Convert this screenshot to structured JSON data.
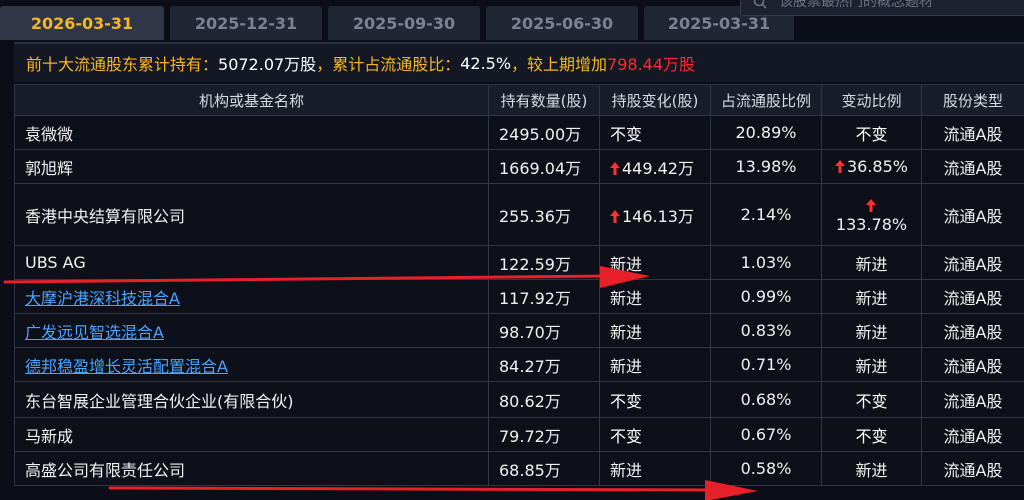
{
  "tabs": [
    {
      "label": "2026-03-31",
      "active": true
    },
    {
      "label": "2025-12-31",
      "active": false
    },
    {
      "label": "2025-09-30",
      "active": false
    },
    {
      "label": "2025-06-30",
      "active": false
    },
    {
      "label": "2025-03-31",
      "active": false
    }
  ],
  "search": {
    "placeholder": "该股票最热门的概念题材"
  },
  "summary": {
    "label_total": "前十大流通股东累计持有：",
    "total_value": "5072.07万股",
    "label_ratio": "，累计占流通股比：",
    "ratio_value": "42.5%",
    "label_change": "，较上期增加",
    "change_value": "798.44万股"
  },
  "table": {
    "headers": [
      "机构或基金名称",
      "持有数量(股)",
      "持股变化(股)",
      "占流通股比例",
      "变动比例",
      "股份类型"
    ],
    "rows": [
      {
        "name": "袁微微",
        "amount": "2495.00万",
        "change": "不变",
        "change_up": false,
        "ratio": "20.89%",
        "vratio": "不变",
        "vratio_up": false,
        "type": "流通A股"
      },
      {
        "name": "郭旭辉",
        "amount": "1669.04万",
        "change": "449.42万",
        "change_up": true,
        "ratio": "13.98%",
        "vratio": "36.85%",
        "vratio_up": true,
        "type": "流通A股"
      },
      {
        "name": "香港中央结算有限公司",
        "amount": "255.36万",
        "change": "146.13万",
        "change_up": true,
        "ratio": "2.14%",
        "vratio": "133.78%",
        "vratio_up": true,
        "type": "流通A股"
      },
      {
        "name": "UBS AG",
        "amount": "122.59万",
        "change": "新进",
        "change_up": false,
        "ratio": "1.03%",
        "vratio": "新进",
        "vratio_up": false,
        "type": "流通A股"
      },
      {
        "name": "大摩沪港深科技混合A",
        "amount": "117.92万",
        "change": "新进",
        "change_up": false,
        "ratio": "0.99%",
        "vratio": "新进",
        "vratio_up": false,
        "type": "流通A股"
      },
      {
        "name": "广发远见智选混合A",
        "amount": "98.70万",
        "change": "新进",
        "change_up": false,
        "ratio": "0.83%",
        "vratio": "新进",
        "vratio_up": false,
        "type": "流通A股"
      },
      {
        "name": "德邦稳盈增长灵活配置混合A",
        "amount": "84.27万",
        "change": "新进",
        "change_up": false,
        "ratio": "0.71%",
        "vratio": "新进",
        "vratio_up": false,
        "type": "流通A股"
      },
      {
        "name": "东台智展企业管理合伙企业(有限合伙)",
        "amount": "80.62万",
        "change": "不变",
        "change_up": false,
        "ratio": "0.68%",
        "vratio": "不变",
        "vratio_up": false,
        "type": "流通A股"
      },
      {
        "name": "马新成",
        "amount": "79.72万",
        "change": "不变",
        "change_up": false,
        "ratio": "0.67%",
        "vratio": "不变",
        "vratio_up": false,
        "type": "流通A股"
      },
      {
        "name": "高盛公司有限责任公司",
        "amount": "68.85万",
        "change": "新进",
        "change_up": false,
        "ratio": "0.58%",
        "vratio": "新进",
        "vratio_up": false,
        "type": "流通A股"
      }
    ]
  },
  "colors": {
    "accent_gold": "#f5b623",
    "increase_red": "#ff3030",
    "link_blue": "#4aa3ff",
    "annotation_red": "#e8202a"
  }
}
